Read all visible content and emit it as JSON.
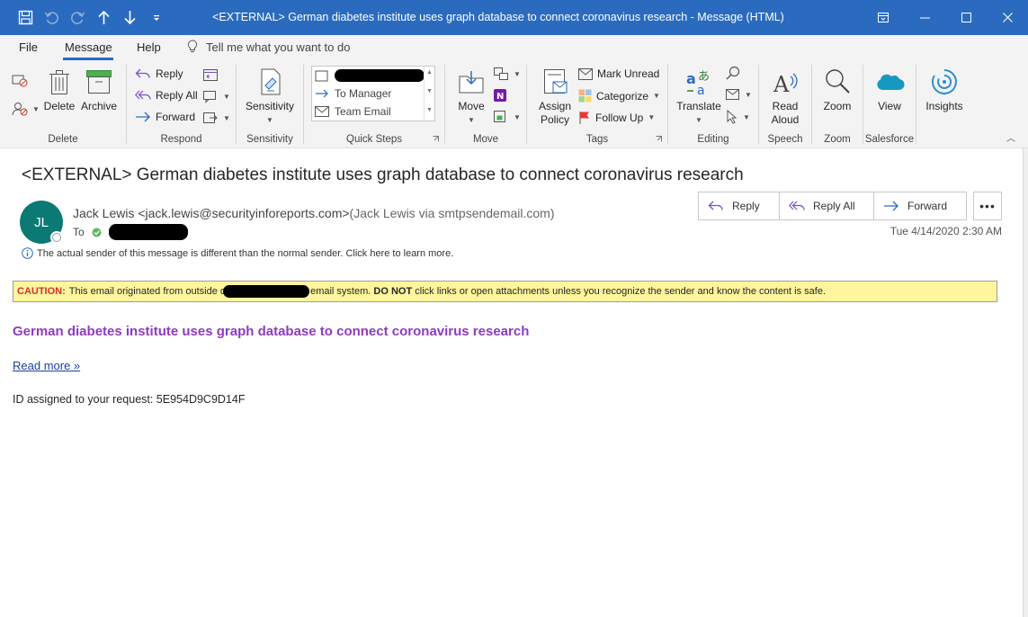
{
  "window": {
    "title": "<EXTERNAL> German diabetes institute uses graph database to connect coronavirus research  -  Message (HTML)"
  },
  "menu": {
    "file": "File",
    "message": "Message",
    "help": "Help",
    "tell_me": "Tell me what you want to do"
  },
  "ribbon": {
    "delete_group": {
      "label": "Delete",
      "delete": "Delete",
      "archive": "Archive"
    },
    "respond_group": {
      "label": "Respond",
      "reply": "Reply",
      "reply_all": "Reply All",
      "forward": "Forward"
    },
    "sensitivity_group": {
      "label": "Sensitivity",
      "sensitivity": "Sensitivity"
    },
    "quick_steps_group": {
      "label": "Quick Steps",
      "items": [
        "To Manager",
        "Team Email"
      ]
    },
    "move_group": {
      "label": "Move",
      "move": "Move"
    },
    "tags_group": {
      "label": "Tags",
      "assign_policy": "Assign Policy",
      "mark_unread": "Mark Unread",
      "categorize": "Categorize",
      "follow_up": "Follow Up"
    },
    "editing_group": {
      "label": "Editing",
      "translate": "Translate"
    },
    "speech_group": {
      "label": "Speech",
      "read_aloud": "Read Aloud"
    },
    "zoom_group": {
      "label": "Zoom",
      "zoom": "Zoom"
    },
    "salesforce_group": {
      "label": "Salesforce",
      "view": "View"
    },
    "insights": "Insights"
  },
  "message": {
    "subject": "<EXTERNAL> German diabetes institute uses graph database to connect coronavirus research",
    "avatar_initials": "JL",
    "sender_name_email": "Jack Lewis <jack.lewis@securityinforeports.com>",
    "sender_via": "(Jack Lewis via smtpsendemail.com)",
    "to_label": "To",
    "date": "Tue 4/14/2020 2:30 AM",
    "info_notice": "The actual sender of this message is different than the normal sender. Click here to learn more.",
    "actions": {
      "reply": "Reply",
      "reply_all": "Reply All",
      "forward": "Forward"
    },
    "caution": {
      "label": "CAUTION:",
      "text_1": "This email originated from outside of",
      "text_2": "email system.",
      "do_not": "DO NOT",
      "text_3": "click links or open attachments unless you recognize the sender and know the content is safe."
    },
    "body": {
      "headline": "German diabetes institute uses graph database to connect coronavirus research",
      "read_more": "Read more »",
      "request_id": "ID assigned to your request: 5E954D9C9D14F"
    }
  },
  "colors": {
    "titlebar": "#2b6bbf",
    "avatar": "#0b7a75",
    "headline": "#8e3bbf",
    "caution_bg": "#fff59d",
    "caution_label": "#d32f2f"
  }
}
